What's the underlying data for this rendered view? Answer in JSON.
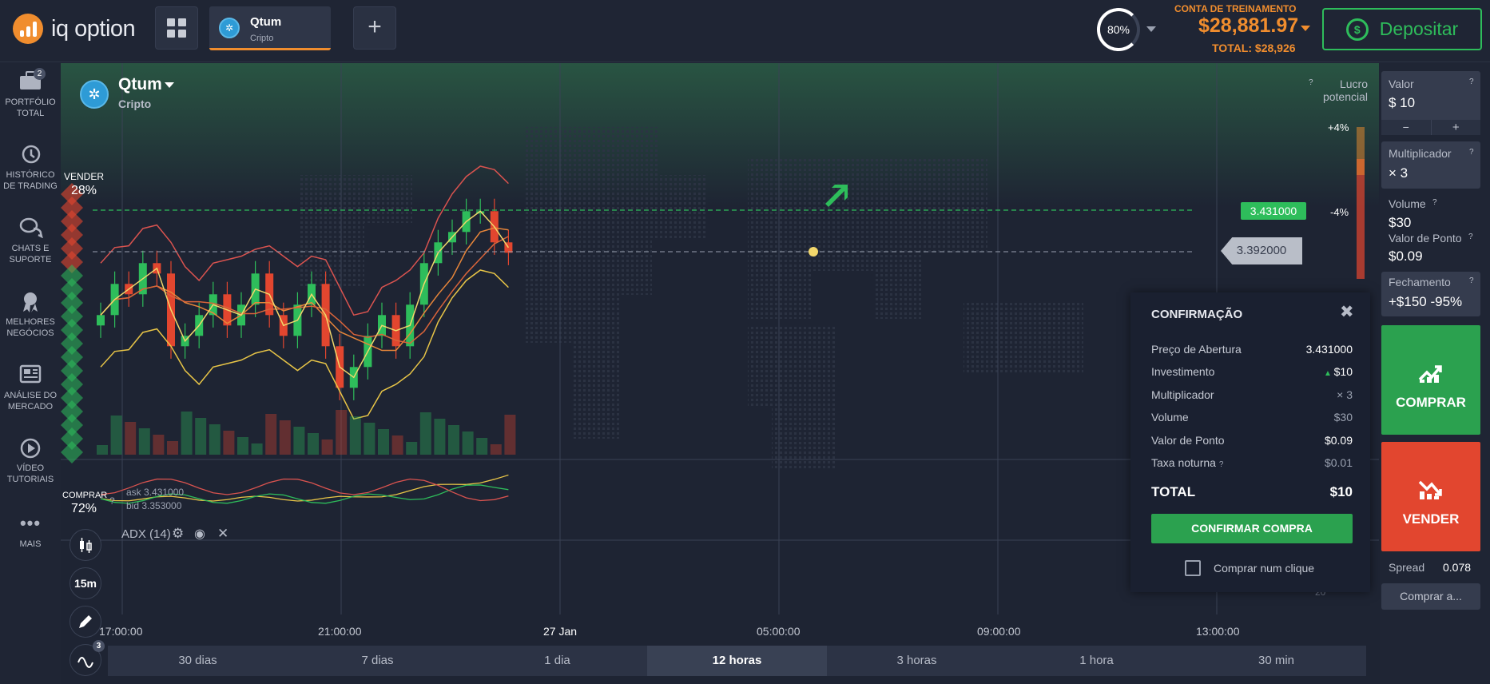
{
  "app": {
    "logo_text": "iq option"
  },
  "header": {
    "asset_tab": {
      "name": "Qtum",
      "category": "Cripto"
    },
    "add_label": "+",
    "payout": "80%",
    "account_type": "CONTA DE TREINAMENTO",
    "balance": "$28,881.97",
    "total": "TOTAL: $28,926",
    "deposit_label": "Depositar"
  },
  "sidebar": {
    "portfolio_badge": "2",
    "items": [
      {
        "label": "PORTFÓLIO TOTAL",
        "icon": "briefcase-icon"
      },
      {
        "label": "HISTÓRICO DE TRADING",
        "icon": "history-icon"
      },
      {
        "label": "CHATS E SUPORTE",
        "icon": "chat-icon"
      },
      {
        "label": "MELHORES NEGÓCIOS",
        "icon": "medal-icon"
      },
      {
        "label": "ANÁLISE DO MERCADO",
        "icon": "newspaper-icon"
      },
      {
        "label": "VÍDEO TUTORIAIS",
        "icon": "play-icon"
      },
      {
        "label": "MAIS",
        "icon": "more-icon"
      }
    ]
  },
  "chart": {
    "asset_name": "Qtum",
    "asset_category": "Cripto",
    "sell_label": "VENDER",
    "sell_pct": "28%",
    "buy_label": "COMPRAR",
    "buy_pct": "72%",
    "ask": "ask 3.431000",
    "bid": "bid 3.353000",
    "indicator": "ADX (14)",
    "timeframe": "15m",
    "tools_badge": "3",
    "profit_label": "Lucro potencial",
    "profit_up": "+4%",
    "profit_down": "-4%",
    "open_price_tag": "3.431000",
    "current_price_tag": "3.392000",
    "adx_level": "20",
    "time_labels": [
      "17:00:00",
      "21:00:00",
      "27 Jan",
      "05:00:00",
      "09:00:00",
      "13:00:00"
    ]
  },
  "chart_data": {
    "type": "line",
    "title": "",
    "series": [
      {
        "values": [
          3.33,
          3.36,
          3.35,
          3.38,
          3.37,
          3.3,
          3.31,
          3.33,
          3.35,
          3.32,
          3.34,
          3.37,
          3.33,
          3.31,
          3.34,
          3.36,
          3.3,
          3.26,
          3.28,
          3.31,
          3.33,
          3.3,
          3.34,
          3.38,
          3.4,
          3.41,
          3.43,
          3.43,
          3.4,
          3.39
        ]
      }
    ]
  },
  "modal": {
    "title": "CONFIRMAÇÃO",
    "rows": [
      {
        "label": "Preço de Abertura",
        "value": "3.431000"
      },
      {
        "label": "Investimento",
        "value": "$10"
      },
      {
        "label": "Multiplicador",
        "value": "× 3"
      },
      {
        "label": "Volume",
        "value": "$30"
      },
      {
        "label": "Valor de Ponto",
        "value": "$0.09"
      },
      {
        "label": "Taxa noturna",
        "value": "$0.01"
      }
    ],
    "total_label": "TOTAL",
    "total_value": "$10",
    "confirm_label": "CONFIRMAR COMPRA",
    "one_click_label": "Comprar num clique"
  },
  "trade_panel": {
    "amount_label": "Valor",
    "amount_value": "$  10",
    "minus": "−",
    "plus": "+",
    "multiplier_label": "Multiplicador",
    "multiplier_value": "× 3",
    "volume_label": "Volume",
    "volume_value": "$30",
    "point_label": "Valor de Ponto",
    "point_value": "$0.09",
    "close_label": "Fechamento",
    "close_value": "+$150 -95%",
    "buy_label": "COMPRAR",
    "sell_label": "VENDER",
    "spread_label": "Spread",
    "spread_value": "0.078",
    "buy_at_label": "Comprar a..."
  },
  "timeframes": [
    "30 dias",
    "7 dias",
    "1 dia",
    "12 horas",
    "3 horas",
    "1 hora",
    "30 min"
  ],
  "active_timeframe": "12 horas",
  "colors": {
    "accent": "#f08d2e",
    "up": "#2ebd5b",
    "down": "#e2462f"
  }
}
